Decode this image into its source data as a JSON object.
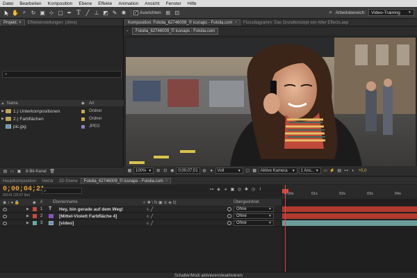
{
  "menu": [
    "Datei",
    "Bearbeiten",
    "Komposition",
    "Ebene",
    "Effekte",
    "Animation",
    "Ansicht",
    "Fenster",
    "Hilfe"
  ],
  "toolbar": {
    "align_label": "Ausrichten",
    "workspace_label": "Arbeitsbereich:",
    "workspace_value": "Video-Training"
  },
  "project_panel": {
    "tab_project": "Projekt: ×",
    "tab_effects": "Effekteinstellungen: (ohne)",
    "search_placeholder": "⌕",
    "header_name": "Name",
    "header_type": "Art",
    "items": [
      {
        "name": "1.) Unterkompositionen",
        "type": "Ordner",
        "kind": "folder",
        "color": "#c9a94a"
      },
      {
        "name": "2.) Farbflächen",
        "type": "Ordner",
        "kind": "folder",
        "color": "#c9a94a"
      },
      {
        "name": "pic.jpg",
        "type": "JPEG",
        "kind": "image",
        "color": "#8f7fc6"
      }
    ],
    "bpc": "8-Bit-Kanal"
  },
  "comp_panel": {
    "tab_comp": "Komposition: Fotolia_62746009_© icsnaps - Fotolia.com",
    "tab_flow": "Flussdiagramm: Das Grundkonzept von After Effects.aep",
    "subtab_active": "Fotolia_62746009_© icsnaps - Fotolia.com",
    "zoom": "100%",
    "timecode": "0;00;07;01",
    "resolution": "Voll",
    "camera": "Aktive Kamera",
    "views": "1 Ans...",
    "exposure": "+0,0"
  },
  "timeline": {
    "tabs": [
      "Hauptkomposition",
      "Vektor",
      "3D Ebene",
      "Fotolia_62746009_© icsnaps - Fotolia.com"
    ],
    "timecode": "0;00;04;21",
    "fps": "00141 (29,97 fps)",
    "col_name": "Ebenenname",
    "col_parent": "Übergeordnet",
    "layers": [
      {
        "num": "1",
        "name": "Hey, bin gerade auf dem Weg!",
        "label_color": "#c94a3a",
        "type": "text",
        "parent": "Ohne",
        "bar_color": "#b03a2e"
      },
      {
        "num": "2",
        "name": "[Mittel-Violett Farbfläche 4]",
        "label_color": "#c94a3a",
        "type": "solid",
        "parent": "Ohne",
        "bar_color": "#b03a2e"
      },
      {
        "num": "3",
        "name": "[video]",
        "label_color": "#6aa9a6",
        "type": "footage",
        "parent": "Ohne",
        "bar_color": "#6e9c9a"
      }
    ],
    "ticks": [
      "0:00s",
      "01s",
      "02s",
      "03s",
      "04s"
    ],
    "bottom_toggle": "Schalter/Modi aktivieren/deaktivieren"
  }
}
